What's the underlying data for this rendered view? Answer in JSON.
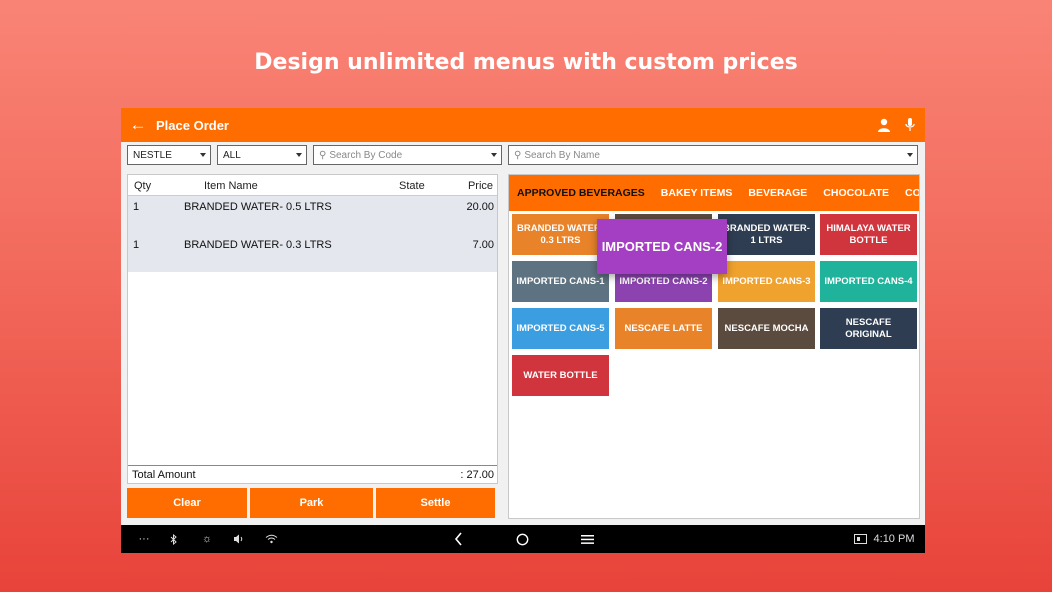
{
  "headline": "Design unlimited menus with custom prices",
  "appbar": {
    "title": "Place Order",
    "back_icon": "arrow-left-icon",
    "user_icon": "user-icon",
    "mic_icon": "mic-icon"
  },
  "filters": {
    "brand": "NESTLE",
    "category": "ALL",
    "search_code_placeholder": "Search By Code",
    "search_name_placeholder": "Search By Name"
  },
  "order": {
    "headers": {
      "qty": "Qty",
      "item": "Item Name",
      "state": "State",
      "price": "Price"
    },
    "rows": [
      {
        "qty": "1",
        "item": "BRANDED WATER- 0.5 LTRS",
        "state": "",
        "price": "20.00"
      },
      {
        "qty": "1",
        "item": "BRANDED WATER- 0.3 LTRS",
        "state": "",
        "price": "7.00"
      }
    ],
    "total_label": "Total Amount",
    "total_value": ": 27.00"
  },
  "buttons": {
    "clear": "Clear",
    "park": "Park",
    "settle": "Settle"
  },
  "categories": [
    "APPROVED BEVERAGES",
    "BAKEY ITEMS",
    "BEVERAGE",
    "CHOCOLATE",
    "COLD BEVERAGES"
  ],
  "active_category": "APPROVED BEVERAGES",
  "tiles": [
    {
      "label": "BRANDED WATER- 0.3 LTRS",
      "color": "#e8832a"
    },
    {
      "label": "",
      "color": "#5b4a3e"
    },
    {
      "label": "BRANDED WATER- 1 LTRS",
      "color": "#2f3d52"
    },
    {
      "label": "HIMALAYA WATER BOTTLE",
      "color": "#d0343c"
    },
    {
      "label": "IMPORTED CANS-1",
      "color": "#5e7381"
    },
    {
      "label": "IMPORTED CANS-2",
      "color": "#8c43b0"
    },
    {
      "label": "IMPORTED CANS-3",
      "color": "#f0a22e"
    },
    {
      "label": "IMPORTED CANS-4",
      "color": "#1fb39b"
    },
    {
      "label": "IMPORTED CANS-5",
      "color": "#3a9ee0"
    },
    {
      "label": "NESCAFE LATTE",
      "color": "#e8832a"
    },
    {
      "label": "NESCAFE MOCHA",
      "color": "#5b4a3e"
    },
    {
      "label": "NESCAFE ORIGINAL",
      "color": "#2f3d52"
    },
    {
      "label": "WATER BOTTLE",
      "color": "#d0343c"
    }
  ],
  "dragged_tile": {
    "label": "IMPORTED CANS-2",
    "color": "#a43ec2"
  },
  "navbar": {
    "icons": [
      "more-icon",
      "bluetooth-icon",
      "brightness-icon",
      "volume-icon",
      "wifi-icon",
      "back-icon",
      "home-icon",
      "recents-icon",
      "screen-icon"
    ],
    "time": "4:10 PM"
  },
  "colors": {
    "accent": "#ff6d00",
    "background": "#f26a5c"
  }
}
